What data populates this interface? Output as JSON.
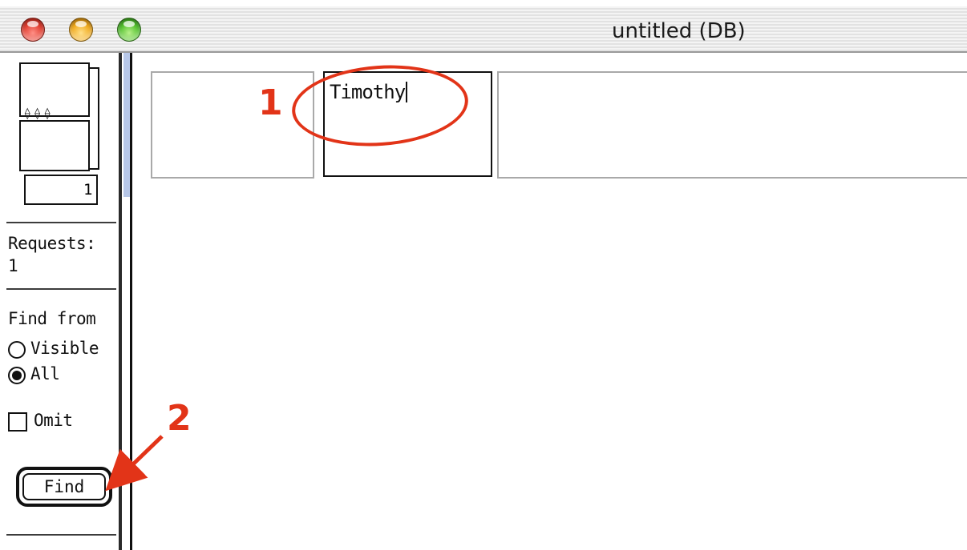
{
  "window": {
    "title": "untitled (DB)"
  },
  "status_area": {
    "book_page": "1",
    "requests_label": "Requests:",
    "requests_count": "1",
    "find_from_label": "Find from",
    "options": [
      {
        "label": "Visible",
        "selected": false
      },
      {
        "label": "All",
        "selected": true
      }
    ],
    "omit_label": "Omit",
    "omit_checked": false,
    "find_button": "Find"
  },
  "fields": [
    {
      "value": ""
    },
    {
      "value": "Timothy"
    },
    {
      "value": ""
    }
  ],
  "annotations": {
    "step1": "1",
    "step2": "2",
    "color": "#e23418"
  }
}
